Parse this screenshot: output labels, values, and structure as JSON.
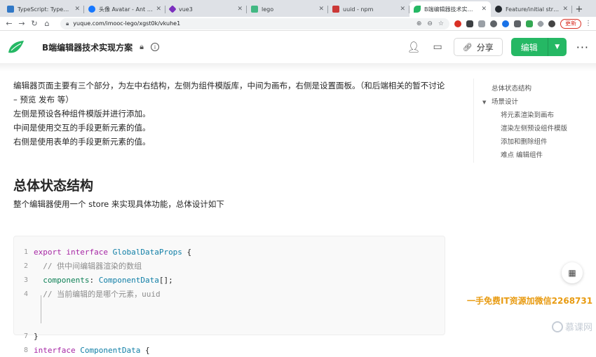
{
  "browser": {
    "tabs": [
      {
        "title": "TypeScript: Typed Jav",
        "color": "#3178c6",
        "active": false
      },
      {
        "title": "头像 Avatar - Ant Desi",
        "color": "#1677ff",
        "active": false
      },
      {
        "title": "vue3",
        "color": "#7b2fbe",
        "active": false
      },
      {
        "title": "lego",
        "color": "#42b883",
        "active": false
      },
      {
        "title": "uuid - npm",
        "color": "#cb3837",
        "active": false
      },
      {
        "title": "B端编辑器技术实现方案",
        "color": "#25b864",
        "active": true
      },
      {
        "title": "Feature/initial structur",
        "color": "#24292f",
        "active": false
      }
    ],
    "url": "yuque.com/imooc-lego/xgst0k/vkuhe1",
    "update_label": "更新"
  },
  "header": {
    "doc_title": "B端编辑器技术实现方案",
    "share_label": "分享",
    "edit_label": "编辑",
    "brand_color": "#25b864"
  },
  "content": {
    "intro": [
      "编辑器页面主要有三个部分，为左中右结构，左侧为组件模版库，中间为画布，右侧是设置面板。（和后端相关的暂不讨论 – 预览 发布 等）",
      "左侧是预设各种组件模版并进行添加。",
      "中间是使用交互的手段更新元素的值。",
      "右侧是使用表单的手段更新元素的值。"
    ],
    "heading": "总体状态结构",
    "desc": "整个编辑器使用一个 store 来实现具体功能，总体设计如下",
    "code": {
      "line_numbers": [
        "1",
        "2",
        "3",
        "4",
        "",
        "",
        "7",
        "8"
      ],
      "l1_kw": "export interface",
      "l1_type": "GlobalDataProps",
      "l1_rest": " {",
      "l2": "  // 供中间编辑器渲染的数组",
      "l3_id": "  components",
      "l3_colon": ": ",
      "l3_type": "ComponentData",
      "l3_rest": "[];",
      "l4": "  // 当前编辑的是哪个元素，uuid",
      "l7": "}",
      "l8_kw": "interface",
      "l8_type": "ComponentData",
      "l8_rest": " {"
    }
  },
  "toc": {
    "items": [
      {
        "label": "总体状态结构"
      },
      {
        "label": "场景设计"
      },
      {
        "label": "将元素渲染到画布"
      },
      {
        "label": "渲染左侧预设组件模版"
      },
      {
        "label": "添加和删除组件"
      },
      {
        "label": "难点 编辑组件"
      }
    ]
  },
  "overlay": {
    "watermark": "一手免费IT资源加微信2268731",
    "brand": "慕课网"
  }
}
